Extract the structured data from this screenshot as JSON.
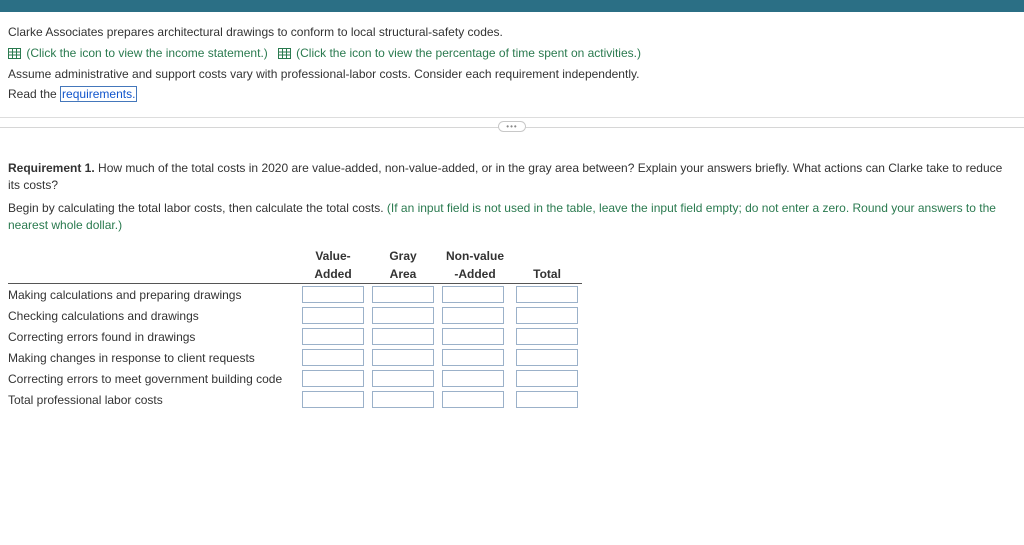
{
  "header": {},
  "intro": {
    "line1": "Clarke Associates prepares architectural drawings to conform to local structural-safety codes.",
    "link1": "(Click the icon to view the income statement.)",
    "link2": "(Click the icon to view the percentage of time spent on activities.)",
    "line2": "Assume administrative and support costs vary with professional-labor costs. Consider each requirement independently.",
    "read_prefix": "Read the ",
    "requirements_label": "requirements.",
    "pill": "•••"
  },
  "req": {
    "title_bold": "Requirement 1.",
    "title_rest": " How much of the total costs in 2020 are value-added, non-value-added, or in the gray area between? Explain your answers briefly. What actions can Clarke take to reduce its costs?",
    "begin": "Begin by calculating the total labor costs, then calculate the total costs. ",
    "hint": "(If an input field is not used in the table, leave the input field empty; do not enter a zero. Round your answers to the nearest whole dollar.)"
  },
  "table": {
    "headers": {
      "col1_a": "Value-",
      "col1_b": "Added",
      "col2_a": "Gray",
      "col2_b": "Area",
      "col3_a": "Non-value",
      "col3_b": "-Added",
      "col4_a": "",
      "col4_b": "Total"
    },
    "rows": [
      {
        "label": "Making calculations and preparing drawings"
      },
      {
        "label": "Checking calculations and drawings"
      },
      {
        "label": "Correcting errors found in drawings"
      },
      {
        "label": "Making changes in response to client requests"
      },
      {
        "label": "Correcting errors to meet government building code"
      },
      {
        "label": "Total professional labor costs"
      }
    ]
  }
}
